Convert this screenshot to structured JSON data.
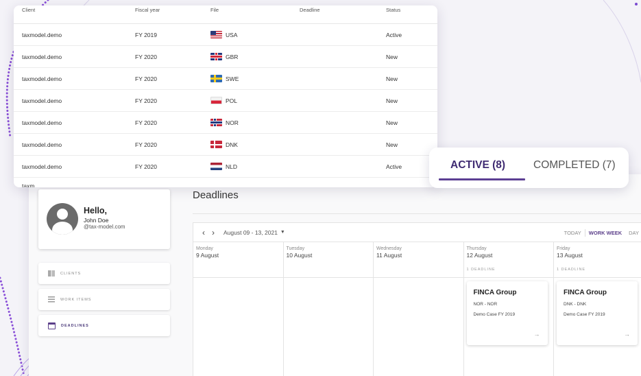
{
  "files_table": {
    "headers": [
      "Client",
      "Fiscal year",
      "File",
      "Deadline",
      "Status"
    ],
    "rows": [
      {
        "client": "taxmodel.demo",
        "year": "FY 2019",
        "file": "USA",
        "flag": "usa",
        "deadline": "",
        "status": "Active"
      },
      {
        "client": "taxmodel.demo",
        "year": "FY 2020",
        "file": "GBR",
        "flag": "gbr",
        "deadline": "",
        "status": "New"
      },
      {
        "client": "taxmodel.demo",
        "year": "FY 2020",
        "file": "SWE",
        "flag": "swe",
        "deadline": "",
        "status": "New"
      },
      {
        "client": "taxmodel.demo",
        "year": "FY 2020",
        "file": "POL",
        "flag": "pol",
        "deadline": "",
        "status": "New"
      },
      {
        "client": "taxmodel.demo",
        "year": "FY 2020",
        "file": "NOR",
        "flag": "nor",
        "deadline": "",
        "status": "New"
      },
      {
        "client": "taxmodel.demo",
        "year": "FY 2020",
        "file": "DNK",
        "flag": "dnk",
        "deadline": "",
        "status": "New"
      },
      {
        "client": "taxmodel.demo",
        "year": "FY 2020",
        "file": "NLD",
        "flag": "nld",
        "deadline": "",
        "status": "Active"
      }
    ],
    "partial_row_text": "taxm"
  },
  "tabs": {
    "active_label": "ACTIVE (8)",
    "completed_label": "COMPLETED (7)"
  },
  "profile": {
    "greeting": "Hello,",
    "name": "John Doe",
    "email": "@tax-model.com"
  },
  "nav": {
    "items": [
      {
        "label": "CLIENTS",
        "icon": "building-icon"
      },
      {
        "label": "WORK ITEMS",
        "icon": "list-icon"
      },
      {
        "label": "DEADLINES",
        "icon": "calendar-icon"
      }
    ]
  },
  "page": {
    "title": "Deadlines"
  },
  "calendar": {
    "date_range": "August 09 - 13, 2021",
    "views": [
      "TODAY",
      "WORK WEEK",
      "DAY"
    ],
    "days": [
      {
        "name": "Monday",
        "date": "9 August",
        "count": ""
      },
      {
        "name": "Tuesday",
        "date": "10 August",
        "count": ""
      },
      {
        "name": "Wednesday",
        "date": "11 August",
        "count": ""
      },
      {
        "name": "Thursday",
        "date": "12 August",
        "count": "1 DEADLINE"
      },
      {
        "name": "Friday",
        "date": "13 August",
        "count": "1 DEADLINE"
      }
    ],
    "events": [
      {
        "day": 3,
        "title": "FINCA Group",
        "code": "NOR - NOR",
        "case": "Demo Case FY 2019"
      },
      {
        "day": 4,
        "title": "FINCA Group",
        "code": "DNK - DNK",
        "case": "Demo Case FY 2019"
      }
    ]
  },
  "colors": {
    "accent": "#5c3f93",
    "accent_dark": "#3f2b72",
    "background": "#f4f3f8"
  }
}
